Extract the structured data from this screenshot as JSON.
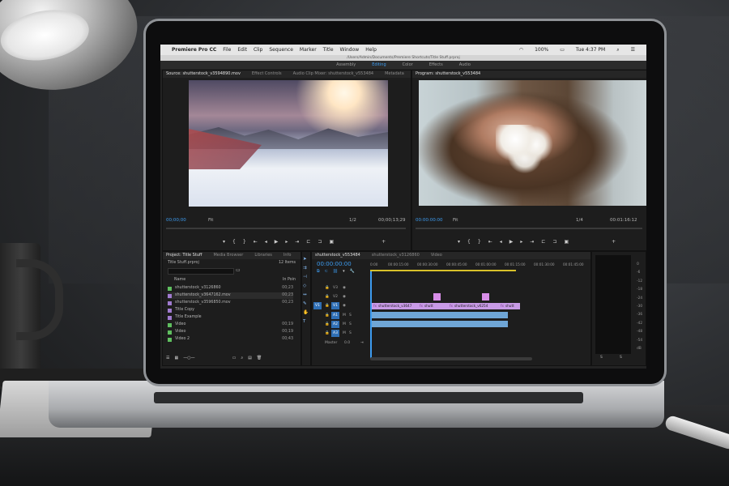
{
  "menubar": {
    "app": "Premiere Pro CC",
    "items": [
      "File",
      "Edit",
      "Clip",
      "Sequence",
      "Marker",
      "Title",
      "Window",
      "Help"
    ],
    "battery": "100%",
    "clock": "Tue 4:37 PM"
  },
  "path": "/Users/Admin/Documents/Premiere Shortcuts/Title Stuff.prproj",
  "workspaces": [
    {
      "label": "Assembly",
      "active": false
    },
    {
      "label": "Editing",
      "active": true
    },
    {
      "label": "Color",
      "active": false
    },
    {
      "label": "Effects",
      "active": false
    },
    {
      "label": "Audio",
      "active": false
    }
  ],
  "source_panel": {
    "tabs": [
      "Source: shutterstock_v3594890.mov",
      "Effect Controls",
      "Audio Clip Mixer: shutterstock_v553484",
      "Metadata"
    ],
    "timecode_in": "00;00;00",
    "fit": "Fit",
    "ratio": "1/2",
    "timecode_out": "00;00;13;29"
  },
  "program_panel": {
    "tab": "Program: shutterstock_v553484",
    "timecode_in": "00:00:00:00",
    "fit": "Fit",
    "ratio": "1/4",
    "timecode_out": "00:01:16:12"
  },
  "project_panel": {
    "tabs": [
      "Project: Title Stuff",
      "Media Browser",
      "Libraries",
      "Info"
    ],
    "file": "Title Stuff.prproj",
    "item_count": "12 Items",
    "col_name": "Name",
    "col_in": "In Poin",
    "items": [
      {
        "name": "shutterstock_v3126860",
        "dur": "00;23",
        "color": "#5fbf5f"
      },
      {
        "name": "shutterstock_v3647162.mov",
        "dur": "00;23",
        "color": "#a07bd0"
      },
      {
        "name": "shutterstock_v3596850.mov",
        "dur": "00;23",
        "color": "#a07bd0"
      },
      {
        "name": "Title Copy",
        "dur": "",
        "color": "#a07bd0"
      },
      {
        "name": "Title Example",
        "dur": "",
        "color": "#a07bd0"
      },
      {
        "name": "Video",
        "dur": "00;19",
        "color": "#5fbf5f"
      },
      {
        "name": "Video",
        "dur": "00;19",
        "color": "#5fbf5f"
      },
      {
        "name": "Video 2",
        "dur": "00;43",
        "color": "#5fbf5f"
      }
    ]
  },
  "timeline": {
    "tabs": [
      "shutterstock_v553484",
      "shutterstock_v3126860",
      "Video"
    ],
    "timecode": "00:00:00:00",
    "ruler": [
      "0:00",
      "00:00:15:00",
      "00:00:30:00",
      "00:00:45:00",
      "00:01:00:00",
      "00:01:15:00",
      "00:01:30:00",
      "00:01:45:00"
    ],
    "tracks": [
      "V3",
      "V2",
      "V1",
      "A1",
      "A2",
      "A3",
      "Master"
    ],
    "master_value": "0.0",
    "clips": [
      {
        "label": "shutterstock_v3647",
        "fx": "fx"
      },
      {
        "label": "shutt",
        "fx": "fx"
      },
      {
        "label": "shutterstock_v6254",
        "fx": "fx"
      },
      {
        "label": "shutt",
        "fx": "fx"
      }
    ]
  },
  "meter": {
    "scale": [
      "0",
      "-6",
      "-12",
      "-18",
      "-24",
      "-30",
      "-36",
      "-42",
      "-48",
      "-54",
      "dB"
    ],
    "footer": [
      "S",
      "S"
    ]
  }
}
